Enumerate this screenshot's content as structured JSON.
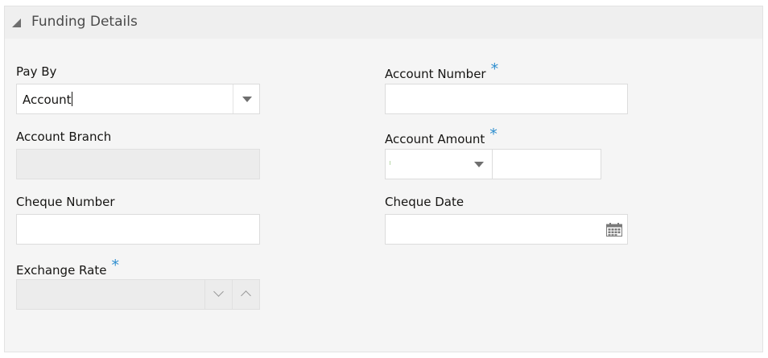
{
  "section": {
    "title": "Funding Details"
  },
  "fields": {
    "pay_by": {
      "label": "Pay By",
      "value": "Account"
    },
    "account_number": {
      "label": "Account Number",
      "required_mark": "*",
      "value": ""
    },
    "account_branch": {
      "label": "Account Branch",
      "value": ""
    },
    "account_amount": {
      "label": "Account Amount",
      "required_mark": "*",
      "currency": "",
      "amount": ""
    },
    "cheque_number": {
      "label": "Cheque Number",
      "value": ""
    },
    "cheque_date": {
      "label": "Cheque Date",
      "value": ""
    },
    "exchange_rate": {
      "label": "Exchange Rate",
      "required_mark": "*",
      "value": ""
    }
  },
  "icons": {
    "collapse": "collapse-triangle-icon",
    "dropdown": "chevron-down-icon",
    "calendar": "calendar-icon",
    "decrement": "chevron-down-icon",
    "increment": "chevron-up-icon"
  },
  "colors": {
    "required": "#2e8ecf",
    "panel_background": "#f5f5f5",
    "disabled_field": "#ececec"
  }
}
